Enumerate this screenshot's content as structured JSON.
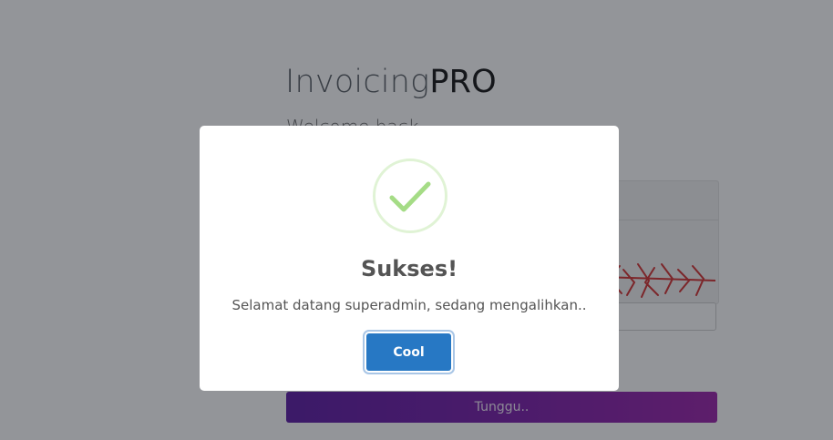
{
  "brand": {
    "part1": "Invoicing",
    "part2": "PRO"
  },
  "login": {
    "welcome": "Welcome back",
    "submit_label": "Tunggu.."
  },
  "modal": {
    "icon": "success-check-icon",
    "title": "Sukses!",
    "message": "Selamat datang superadmin, sedang mengalihkan..",
    "confirm_label": "Cool"
  },
  "colors": {
    "confirm_button": "#2778c4",
    "success_check": "#a5dc86",
    "submit_gradient_start": "#5a17a3",
    "submit_gradient_end": "#9a1fa8"
  }
}
